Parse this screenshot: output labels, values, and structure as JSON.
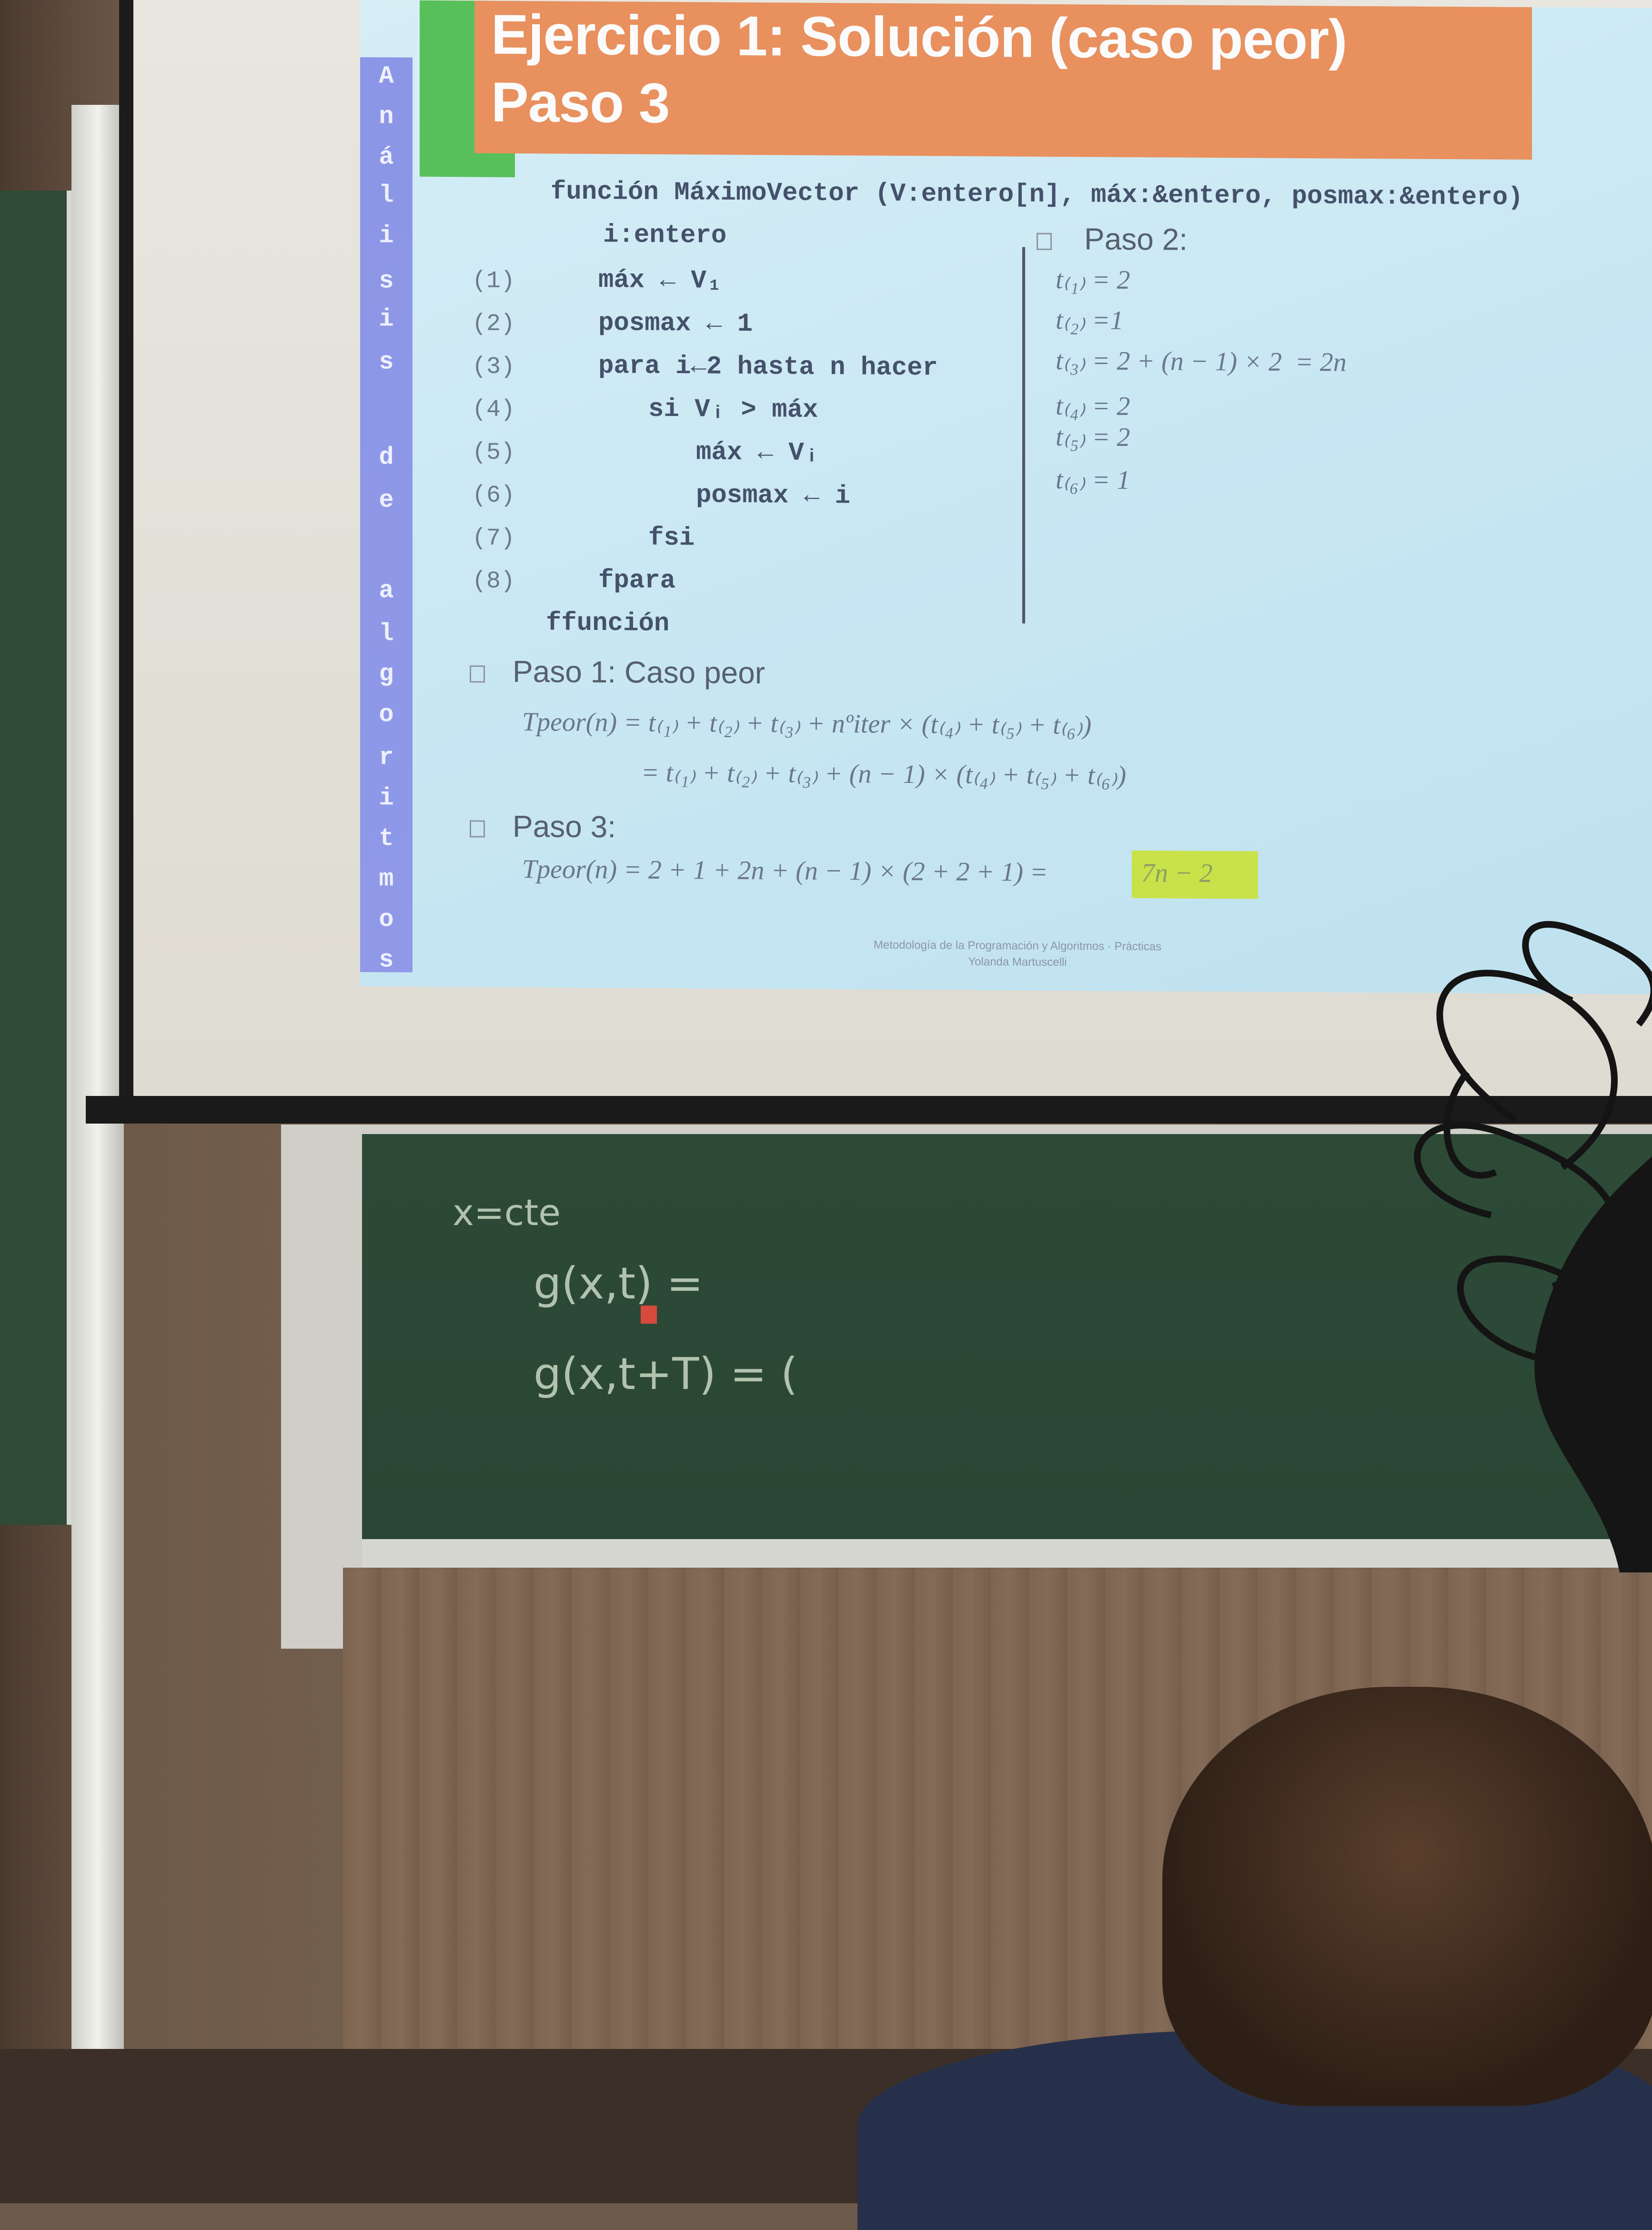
{
  "slide": {
    "title_line1": "Ejercicio 1: Solución (caso peor)",
    "title_line2": "Paso 3",
    "side_label_letters": [
      "A",
      "n",
      "á",
      "l",
      "i",
      "s",
      "i",
      "s",
      "d",
      "e",
      "a",
      "l",
      "g",
      "o",
      "r",
      "i",
      "t",
      "m",
      "o",
      "s"
    ],
    "code": {
      "header": "función MáximoVector (V:entero[n], máx:&entero, posmax:&entero)",
      "decl": "i:entero",
      "lines": [
        {
          "num": "(1)",
          "text": "máx ← V₁"
        },
        {
          "num": "(2)",
          "text": "posmax ← 1"
        },
        {
          "num": "(3)",
          "text": "para i←2 hasta n hacer"
        },
        {
          "num": "(4)",
          "text": "si Vᵢ > máx"
        },
        {
          "num": "(5)",
          "text": "máx ← Vᵢ"
        },
        {
          "num": "(6)",
          "text": "posmax ← i"
        },
        {
          "num": "(7)",
          "text": "fsi"
        },
        {
          "num": "(8)",
          "text": "fpara"
        }
      ],
      "footer": "ffunción"
    },
    "paso2": {
      "heading": "Paso 2:",
      "t1": "t₍₁₎ = 2",
      "t2": "t₍₂₎ =1",
      "t3": "t₍₃₎ = 2 + (n − 1) × 2  = 2n",
      "t4": "t₍₄₎ = 2",
      "t5": "t₍₅₎ = 2",
      "t6": "t₍₆₎ = 1"
    },
    "paso1": {
      "heading": "Paso 1: Caso peor",
      "eq1": "Tpeor(n) = t₍₁₎ + t₍₂₎ + t₍₃₎ + nºiter × (t₍₄₎ + t₍₅₎ + t₍₆₎)",
      "eq2": "= t₍₁₎ + t₍₂₎ + t₍₃₎ + (n − 1) × (t₍₄₎ + t₍₅₎ + t₍₆₎)"
    },
    "paso3": {
      "heading": "Paso 3:",
      "eq": "Tpeor(n) = 2 + 1 + 2n + (n − 1) × (2 + 2 + 1) =",
      "result": "7n − 2"
    },
    "footer_line1": "Metodología de la Programación y Algoritmos · Prácticas",
    "footer_line2": "Yolanda Martuscelli"
  },
  "chalkboard": {
    "line1": "x=cte",
    "line2": "g(x,t) =",
    "line3": "g(x,t+T) = ("
  },
  "colors": {
    "title_band": "#e8905e",
    "side_strip": "#8c96e6",
    "result_highlight": "#c9e24a",
    "chalkboard": "#2d4a37"
  }
}
